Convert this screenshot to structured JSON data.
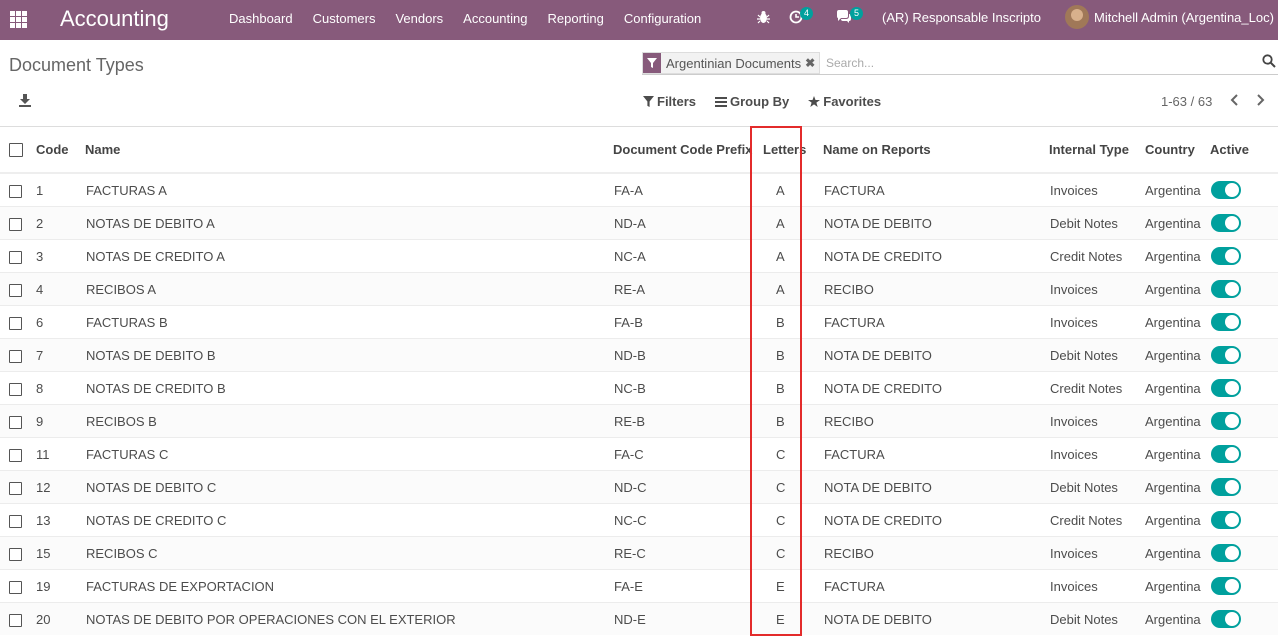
{
  "navbar": {
    "app_title": "Accounting",
    "menu": [
      "Dashboard",
      "Customers",
      "Vendors",
      "Accounting",
      "Reporting",
      "Configuration"
    ],
    "activity_count": "4",
    "messages_count": "5",
    "company": "(AR) Responsable Inscripto",
    "user": "Mitchell Admin (Argentina_Loc)"
  },
  "control_panel": {
    "title": "Document Types",
    "facet": "Argentinian Documents",
    "search_placeholder": "Search...",
    "filters_label": "Filters",
    "group_by_label": "Group By",
    "favorites_label": "Favorites",
    "pager": "1-63 / 63"
  },
  "table": {
    "headers": {
      "code": "Code",
      "name": "Name",
      "prefix": "Document Code Prefix",
      "letters": "Letters",
      "report_name": "Name on Reports",
      "internal_type": "Internal Type",
      "country": "Country",
      "active": "Active"
    },
    "rows": [
      {
        "code": "1",
        "name": "FACTURAS A",
        "prefix": "FA-A",
        "letter": "A",
        "report_name": "FACTURA",
        "internal_type": "Invoices",
        "country": "Argentina"
      },
      {
        "code": "2",
        "name": "NOTAS DE DEBITO A",
        "prefix": "ND-A",
        "letter": "A",
        "report_name": "NOTA DE DEBITO",
        "internal_type": "Debit Notes",
        "country": "Argentina"
      },
      {
        "code": "3",
        "name": "NOTAS DE CREDITO A",
        "prefix": "NC-A",
        "letter": "A",
        "report_name": "NOTA DE CREDITO",
        "internal_type": "Credit Notes",
        "country": "Argentina"
      },
      {
        "code": "4",
        "name": "RECIBOS A",
        "prefix": "RE-A",
        "letter": "A",
        "report_name": "RECIBO",
        "internal_type": "Invoices",
        "country": "Argentina"
      },
      {
        "code": "6",
        "name": "FACTURAS B",
        "prefix": "FA-B",
        "letter": "B",
        "report_name": "FACTURA",
        "internal_type": "Invoices",
        "country": "Argentina"
      },
      {
        "code": "7",
        "name": "NOTAS DE DEBITO B",
        "prefix": "ND-B",
        "letter": "B",
        "report_name": "NOTA DE DEBITO",
        "internal_type": "Debit Notes",
        "country": "Argentina"
      },
      {
        "code": "8",
        "name": "NOTAS DE CREDITO B",
        "prefix": "NC-B",
        "letter": "B",
        "report_name": "NOTA DE CREDITO",
        "internal_type": "Credit Notes",
        "country": "Argentina"
      },
      {
        "code": "9",
        "name": "RECIBOS B",
        "prefix": "RE-B",
        "letter": "B",
        "report_name": "RECIBO",
        "internal_type": "Invoices",
        "country": "Argentina"
      },
      {
        "code": "11",
        "name": "FACTURAS C",
        "prefix": "FA-C",
        "letter": "C",
        "report_name": "FACTURA",
        "internal_type": "Invoices",
        "country": "Argentina"
      },
      {
        "code": "12",
        "name": "NOTAS DE DEBITO C",
        "prefix": "ND-C",
        "letter": "C",
        "report_name": "NOTA DE DEBITO",
        "internal_type": "Debit Notes",
        "country": "Argentina"
      },
      {
        "code": "13",
        "name": "NOTAS DE CREDITO C",
        "prefix": "NC-C",
        "letter": "C",
        "report_name": "NOTA DE CREDITO",
        "internal_type": "Credit Notes",
        "country": "Argentina"
      },
      {
        "code": "15",
        "name": "RECIBOS C",
        "prefix": "RE-C",
        "letter": "C",
        "report_name": "RECIBO",
        "internal_type": "Invoices",
        "country": "Argentina"
      },
      {
        "code": "19",
        "name": "FACTURAS DE EXPORTACION",
        "prefix": "FA-E",
        "letter": "E",
        "report_name": "FACTURA",
        "internal_type": "Invoices",
        "country": "Argentina"
      },
      {
        "code": "20",
        "name": "NOTAS DE DEBITO POR OPERACIONES CON EL EXTERIOR",
        "prefix": "ND-E",
        "letter": "E",
        "report_name": "NOTA DE DEBITO",
        "internal_type": "Debit Notes",
        "country": "Argentina"
      }
    ]
  },
  "colors": {
    "brand": "#875a7b",
    "toggle": "#00a09d",
    "highlight": "#e32b2b"
  }
}
